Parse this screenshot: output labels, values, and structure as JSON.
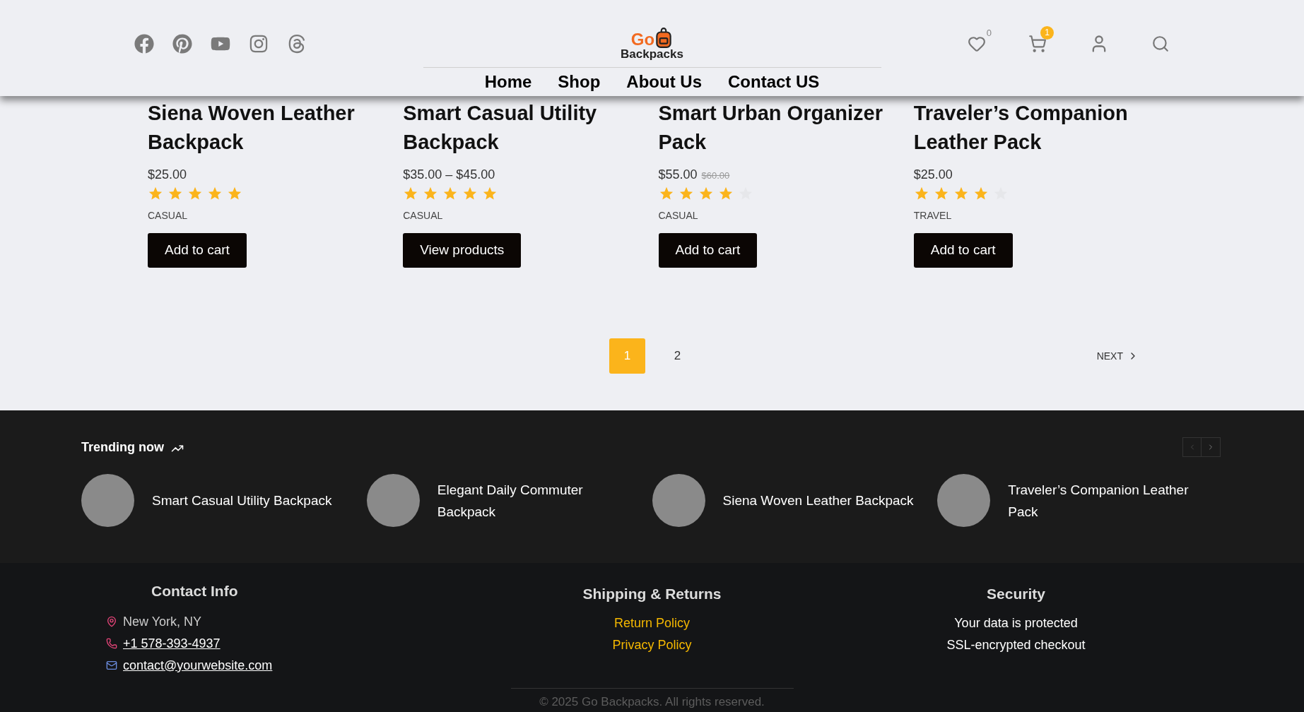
{
  "header": {
    "logo": {
      "accent": "Go",
      "name": "Backpacks"
    },
    "nav": [
      {
        "label": "Home"
      },
      {
        "label": "Shop"
      },
      {
        "label": "About Us"
      },
      {
        "label": "Contact US"
      }
    ],
    "wishlist_count": "0",
    "cart_count": "1"
  },
  "products": [
    {
      "title": "Siena Woven Leather Backpack",
      "price": "$25.00",
      "stars": 5,
      "category": "CASUAL",
      "button": "Add to cart"
    },
    {
      "title": "Smart Casual Utility Backpack",
      "price": "$35.00 – $45.00",
      "stars": 5,
      "category": "CASUAL",
      "button": "View products"
    },
    {
      "title": "Smart Urban Organizer Pack",
      "price": "$55.00",
      "old_price": "$60.00",
      "stars": 4,
      "category": "CASUAL",
      "button": "Add to cart"
    },
    {
      "title": "Traveler’s Companion Leather Pack",
      "price": "$25.00",
      "stars": 4,
      "category": "TRAVEL",
      "button": "Add to cart"
    }
  ],
  "pagination": {
    "pages": [
      {
        "label": "1",
        "selected": true
      },
      {
        "label": "2",
        "selected": false
      }
    ],
    "next": "NEXT"
  },
  "trending": {
    "title": "Trending now",
    "items": [
      {
        "name": "Smart Casual Utility Backpack"
      },
      {
        "name": "Elegant Daily Commuter Backpack"
      },
      {
        "name": "Siena Woven Leather Backpack"
      },
      {
        "name": "Traveler’s Companion Leather Pack"
      }
    ]
  },
  "footer": {
    "contact": {
      "title": "Contact Info",
      "location": "New York, NY",
      "phone": "+1 578-393-4937",
      "email": "contact@yourwebsite.com"
    },
    "shipping": {
      "title": "Shipping & Returns",
      "links": [
        "Return Policy",
        "Privacy Policy"
      ]
    },
    "security": {
      "title": "Security",
      "lines": [
        "Your data is protected",
        "SSL-encrypted checkout"
      ]
    },
    "copyright": "© 2025 Go Backpacks. All rights reserved."
  }
}
